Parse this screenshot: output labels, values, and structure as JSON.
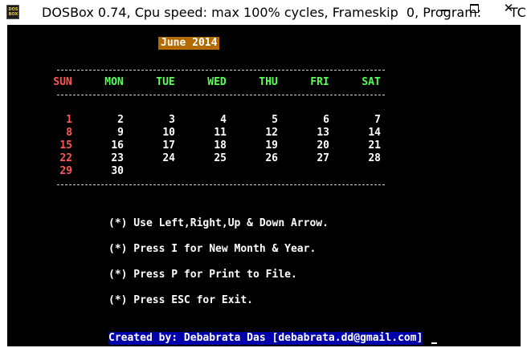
{
  "window": {
    "title": "DOSBox 0.74, Cpu speed: max 100% cycles, Frameskip  0, Program:       TC",
    "icon": "dosbox-icon",
    "icon_text_top": "DOS",
    "icon_text_bottom": "BOX",
    "close_glyph": "✕"
  },
  "calendar": {
    "month_title": "June 2014",
    "day_headers": [
      {
        "label": "SUN",
        "color": "#ff5555"
      },
      {
        "label": "MON",
        "color": "#55ff55"
      },
      {
        "label": "TUE",
        "color": "#55ff55"
      },
      {
        "label": "WED",
        "color": "#55ff55"
      },
      {
        "label": "THU",
        "color": "#55ff55"
      },
      {
        "label": "FRI",
        "color": "#55ff55"
      },
      {
        "label": "SAT",
        "color": "#55ff55"
      }
    ],
    "weeks": [
      [
        "1",
        "2",
        "3",
        "4",
        "5",
        "6",
        "7"
      ],
      [
        "8",
        "9",
        "10",
        "11",
        "12",
        "13",
        "14"
      ],
      [
        "15",
        "16",
        "17",
        "18",
        "19",
        "20",
        "21"
      ],
      [
        "22",
        "23",
        "24",
        "25",
        "26",
        "27",
        "28"
      ],
      [
        "29",
        "30",
        "",
        "",
        "",
        "",
        ""
      ]
    ],
    "sunday_color": "#ff5555",
    "weekday_color": "#ffffff"
  },
  "instructions": [
    "(*) Use Left,Right,Up & Down Arrow.",
    "(*) Press I for New Month & Year.",
    "(*) Press P for Print to File.",
    "(*) Press ESC for Exit."
  ],
  "credit": "Created by: Debabrata Das [debabrata.dd@gmail.com]",
  "colors": {
    "screen_bg": "#000000",
    "month_bg": "#b36b00",
    "credit_bg": "#0000aa"
  }
}
